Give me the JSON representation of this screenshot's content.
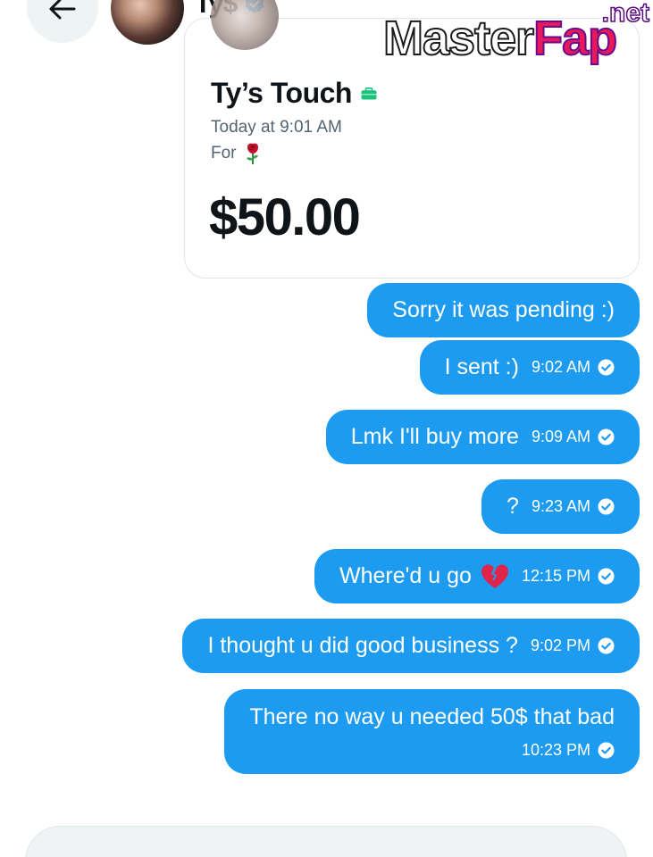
{
  "header": {
    "contact_name": "Ty$"
  },
  "watermark": {
    "main_part1": "Master",
    "main_part2": "Fap",
    "suffix": ".net"
  },
  "payment_card": {
    "title": "Ty’s Touch",
    "time": "Today at 9:01 AM",
    "for_label": "For",
    "amount": "$50.00"
  },
  "messages": [
    {
      "text": "Sorry it was pending :)",
      "time": ""
    },
    {
      "text": "I sent :)",
      "time": "9:02 AM"
    },
    {
      "text": "Lmk I'll buy more",
      "time": "9:09 AM"
    },
    {
      "text": "?",
      "time": "9:23 AM"
    },
    {
      "text": "Where'd u go",
      "time": "12:15 PM"
    },
    {
      "text": "I thought u did good business ?",
      "time": "9:02 PM"
    },
    {
      "text": "There no way u needed 50$ that bad",
      "time": "10:23 PM"
    }
  ],
  "colors": {
    "bubble": "#1d9bf0",
    "verified": "#1d9bf0",
    "text_primary": "#0f1419",
    "text_secondary": "#536471"
  },
  "icons": {
    "back": "arrow-left-icon",
    "verified": "verified-badge-icon",
    "briefcase": "briefcase-icon",
    "rose": "rose-icon",
    "broken_heart": "broken-heart-icon",
    "read_receipt": "check-circle-icon"
  }
}
